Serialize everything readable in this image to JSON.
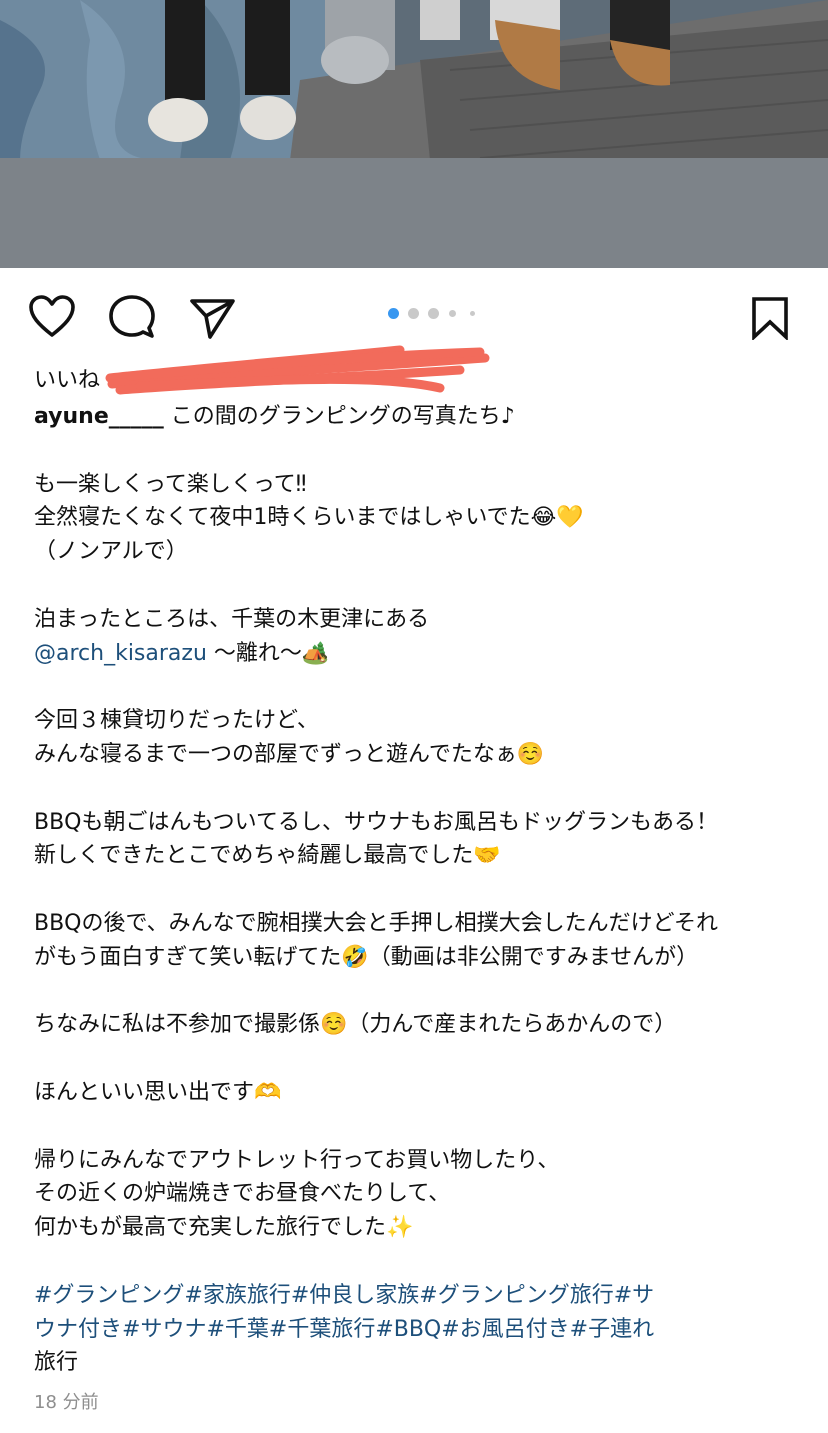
{
  "post": {
    "likes_prefix": "いいね",
    "username": "ayune_____",
    "caption_first": "この間のグランピングの写真たち♪",
    "paragraphs": [
      [
        "も一楽しくって楽しくって‼︎",
        "全然寝たくなくて夜中1時くらいまではしゃいでた😂💛",
        "（ノンアルで）"
      ],
      [
        "泊まったところは、千葉の木更津にある"
      ],
      [
        "今回３棟貸切りだったけど、",
        "みんな寝るまで一つの部屋でずっと遊んでたなぁ☺️"
      ],
      [
        "BBQも朝ごはんもついてるし、サウナもお風呂もドッグランもある！",
        "新しくできたとこでめちゃ綺麗し最高でした🤝"
      ],
      [
        "BBQの後で、みんなで腕相撲大会と手押し相撲大会したんだけどそれ",
        "がもう面白すぎて笑い転げてた🤣（動画は非公開ですみませんが）"
      ],
      [
        "ちなみに私は不参加で撮影係☺️（力んで産まれたらあかんので）"
      ],
      [
        "ほんといい思い出です🫶"
      ],
      [
        "帰りにみんなでアウトレット行ってお買い物したり、",
        "その近くの炉端焼きでお昼食べたりして、",
        "何かもが最高で充実した旅行でした✨"
      ]
    ],
    "mention": "@arch_kisarazu",
    "mention_suffix": " 〜離れ〜🏕️",
    "hashtags_line1": "#グランピング#家族旅行#仲良し家族#グランピング旅行#サ",
    "hashtags_line2_plain": "ウナ付き",
    "hashtags_line2_tags": "#サウナ#千葉#千葉旅行#BBQ#お風呂付き#子連れ",
    "hashtags_line3_plain": "旅行",
    "timestamp": "18 分前"
  },
  "icons": [
    "heart-icon",
    "comment-icon",
    "send-icon",
    "bookmark-icon"
  ],
  "carousel": {
    "count": 5,
    "active_index": 0
  },
  "colors": {
    "link": "#1d4f7a",
    "active_dot": "#3897f0",
    "scribble": "#f26b5b",
    "muted": "#8e8e8e"
  }
}
